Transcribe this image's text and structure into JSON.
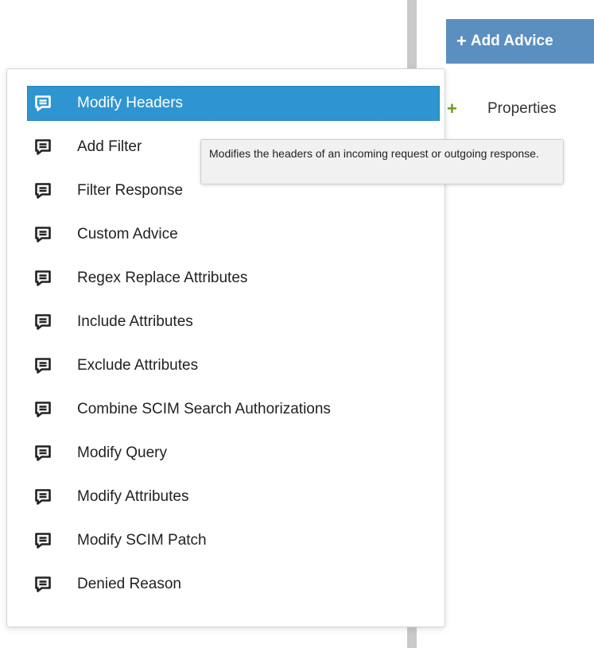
{
  "header": {
    "add_advice_label": "Add Advice",
    "add_advice_plus": "+"
  },
  "properties": {
    "label": "Properties",
    "icon": "plus-icon",
    "icon_char": "+",
    "icon_color": "#6a9a1f"
  },
  "advice_menu": {
    "items": [
      {
        "label": "Modify Headers",
        "icon": "comment-icon",
        "active": true
      },
      {
        "label": "Add Filter",
        "icon": "comment-icon"
      },
      {
        "label": "Filter Response",
        "icon": "comment-icon"
      },
      {
        "label": "Custom Advice",
        "icon": "comment-icon"
      },
      {
        "label": "Regex Replace Attributes",
        "icon": "comment-icon"
      },
      {
        "label": "Include Attributes",
        "icon": "comment-icon"
      },
      {
        "label": "Exclude Attributes",
        "icon": "comment-icon"
      },
      {
        "label": "Combine SCIM Search Authorizations",
        "icon": "comment-icon"
      },
      {
        "label": "Modify Query",
        "icon": "comment-icon"
      },
      {
        "label": "Modify Attributes",
        "icon": "comment-icon"
      },
      {
        "label": "Modify SCIM Patch",
        "icon": "comment-icon"
      },
      {
        "label": "Denied Reason",
        "icon": "comment-icon"
      }
    ]
  },
  "tooltip": {
    "text": "Modifies the headers of an incoming request or outgoing response."
  },
  "colors": {
    "button_bg": "#5b8fc0",
    "active_item_bg": "#2f95d1",
    "divider": "#c9c9c9",
    "tooltip_bg": "#f1f1f1"
  }
}
